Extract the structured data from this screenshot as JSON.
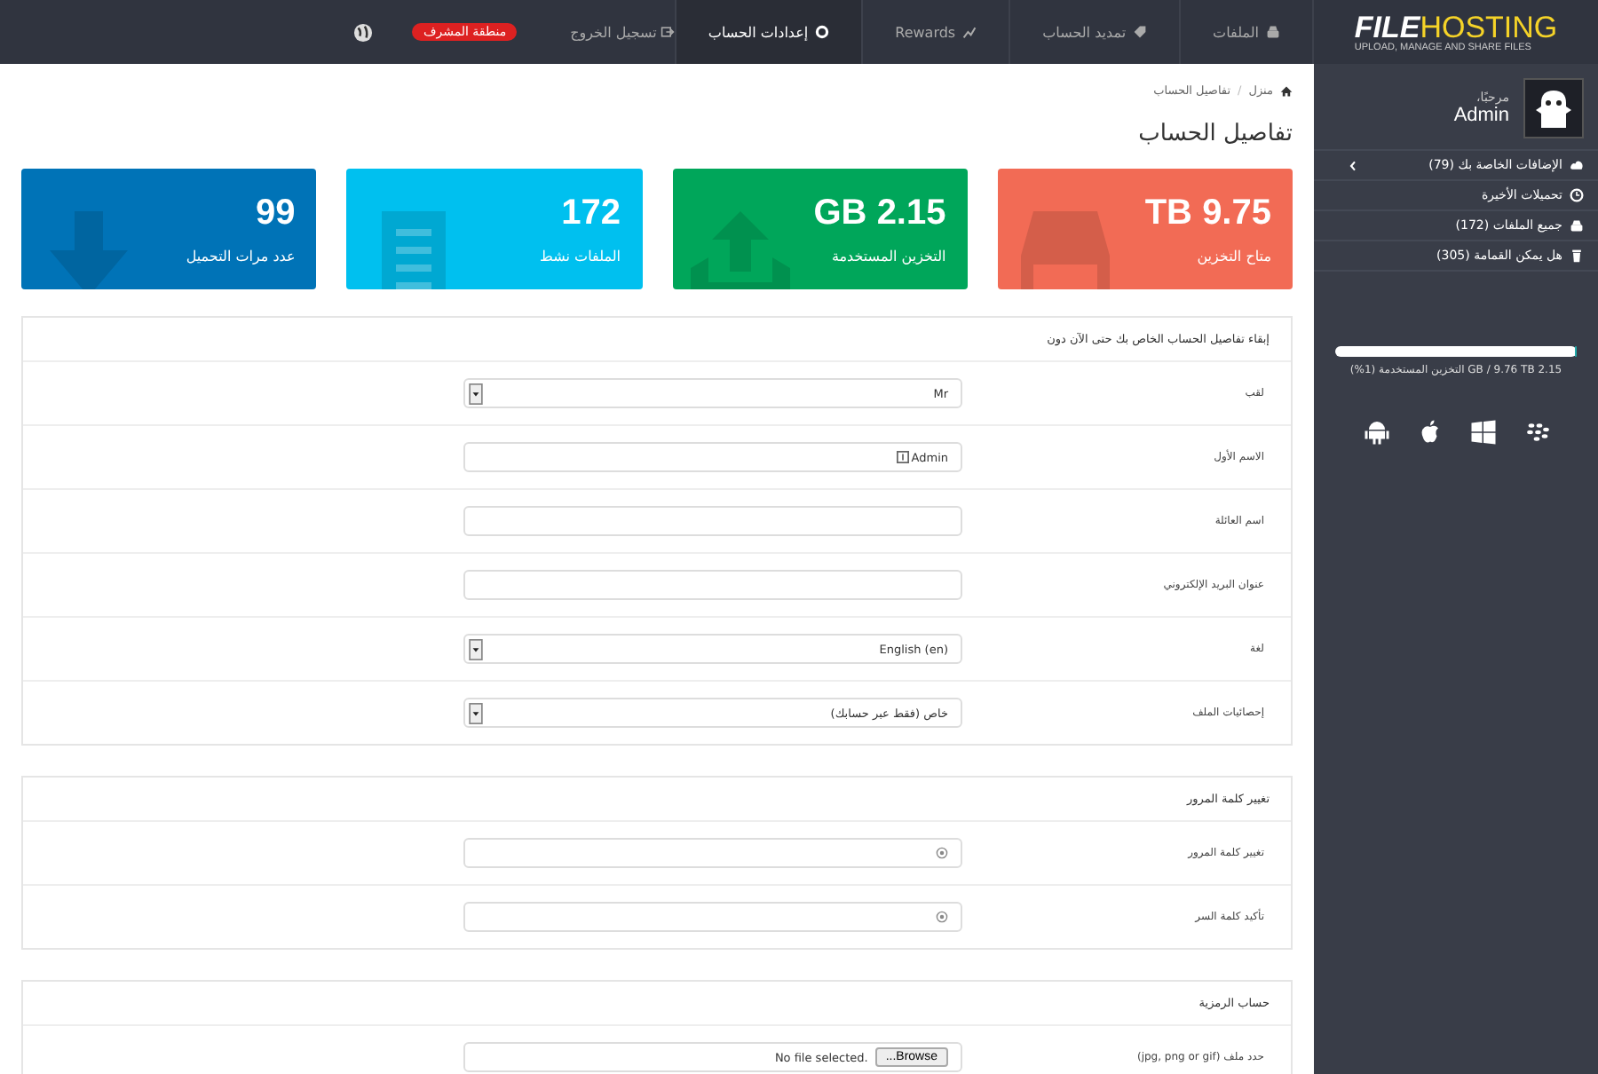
{
  "logo": {
    "part_1": "FILE",
    "part_2": "HOSTING",
    "tagline": "UPLOAD, MANAGE AND SHARE FILES"
  },
  "nav": [
    {
      "label": "الملفات",
      "selected": false
    },
    {
      "label": "تمديد الحساب",
      "selected": false
    },
    {
      "label": "Rewards",
      "selected": false
    },
    {
      "label": "إعدادات الحساب",
      "selected": true
    }
  ],
  "admin_badge": "منطقة المشرف",
  "logout": "تسجيل الخروج",
  "sidebar": {
    "greeting": "مرحبًا،",
    "username": "Admin",
    "items": [
      {
        "label": "الإضافات الخاصة بك (79)",
        "expandable": true
      },
      {
        "label": "تحميلات الأخيرة",
        "expandable": false
      },
      {
        "label": "جميع الملفات (172)",
        "expandable": false
      },
      {
        "label": "هل يمكن القمامة (305)",
        "expandable": false
      }
    ],
    "storage": {
      "level": 0.01,
      "text": "2.15 GB / 9.76 TB التخزين المستخدمة (1%)"
    }
  },
  "breadcrumb": [
    "منزل",
    "تفاصيل الحساب"
  ],
  "breadcrumb_separator": "/",
  "page_title": "تفاصيل الحساب",
  "stats": [
    {
      "value": "9.75 TB",
      "label": "متاح التخزين",
      "color": "#f26b55"
    },
    {
      "value": "2.15 GB",
      "label": "التخزين المستخدمة",
      "color": "#00a65a"
    },
    {
      "value": "172",
      "label": "الملفات نشط",
      "color": "#00c0ef"
    },
    {
      "value": "99",
      "label": "عدد مرات التحميل",
      "color": "#0073b7"
    }
  ],
  "sections": [
    {
      "title": "إبقاء تفاصيل الحساب الخاص بك حتى الآن دون",
      "fields": [
        {
          "kind": "select",
          "label": "لقب",
          "value": "Mr"
        },
        {
          "kind": "text",
          "label": "الاسم الأول",
          "value": "Admin",
          "icon": true
        },
        {
          "kind": "text",
          "label": "اسم العائلة"
        },
        {
          "kind": "text",
          "label": "عنوان البريد الإلكتروني"
        },
        {
          "kind": "select",
          "label": "لغة",
          "value": "English (en)"
        },
        {
          "kind": "select",
          "label": "إحصائيات الملف",
          "value": "خاص (فقط عبر حسابك)"
        }
      ]
    },
    {
      "title": "تغيير كلمة المرور",
      "fields": [
        {
          "kind": "password",
          "label": "تغيير كلمة المرور"
        },
        {
          "kind": "password",
          "label": "تأكيد كلمة السر"
        }
      ]
    },
    {
      "title": "حساب الرمزية",
      "fields": [
        {
          "kind": "file",
          "label": "حدد ملف (jpg, png or gif)",
          "button": "Browse...",
          "status": "No file selected."
        }
      ]
    }
  ]
}
